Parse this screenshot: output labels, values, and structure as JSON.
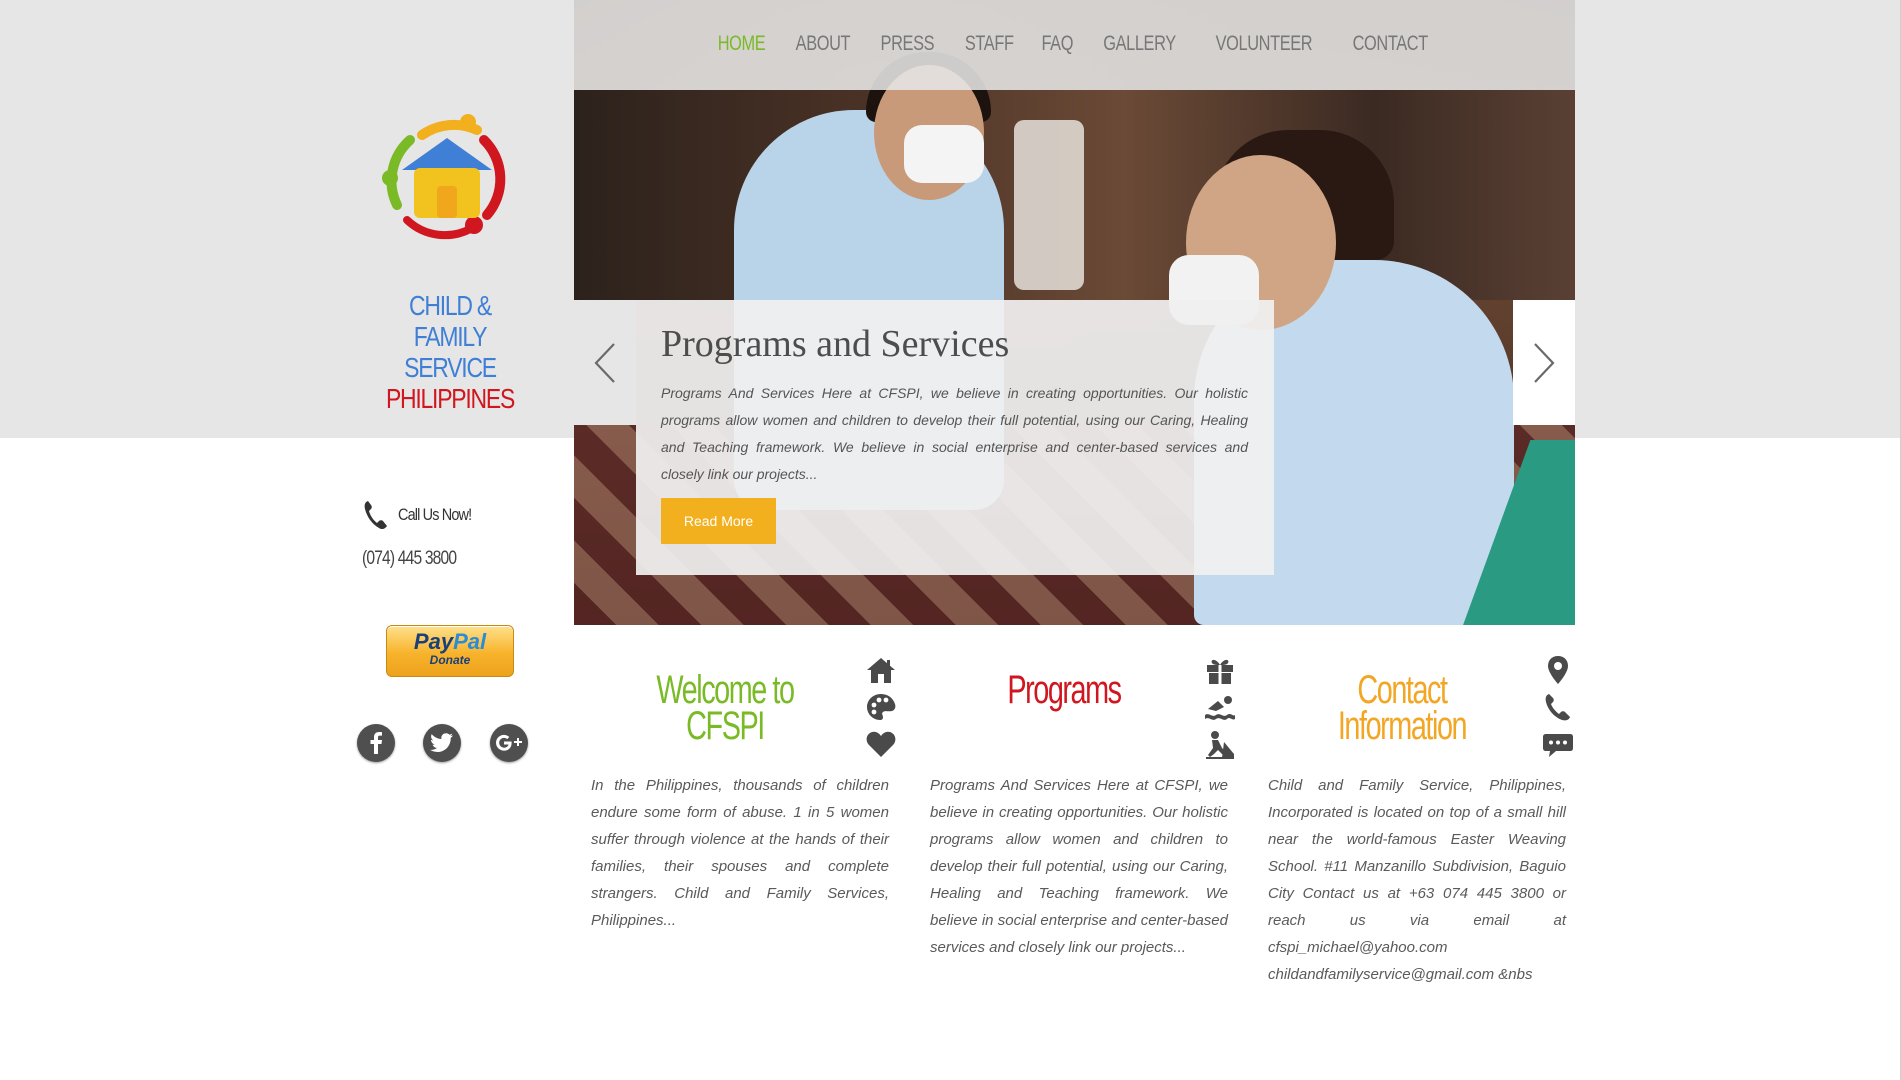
{
  "nav": {
    "items": [
      "HOME",
      "ABOUT",
      "PRESS",
      "STAFF",
      "FAQ",
      "GALLERY",
      "VOLUNTEER",
      "CONTACT"
    ],
    "active": "HOME"
  },
  "logo": {
    "line1": "CHILD & FAMILY",
    "line2": "SERVICE",
    "line3": "PHILIPPINES"
  },
  "sidebar": {
    "call_label": "Call Us Now!",
    "phone": "(074) 445 3800",
    "paypal_logo_part1": "Pay",
    "paypal_logo_part2": "Pal",
    "paypal_sub": "Donate"
  },
  "slider": {
    "title": "Programs and Services",
    "text": "Programs And Services Here at CFSPI, we believe in creating opportunities. Our holistic programs allow women and children to develop  their full potential, using our Caring, Healing and Teaching framework. We believe in social enterprise and center-based services and closely link our projects...",
    "button": "Read More"
  },
  "columns": [
    {
      "title": "Welcome to CFSPI",
      "text": "In the Philippines, thousands of children endure some form of abuse. 1 in 5 women suffer through violence at the hands of their families, their spouses and complete strangers. Child and Family Services, Philippines...",
      "icons": [
        "house-icon",
        "palette-icon",
        "heart-icon"
      ]
    },
    {
      "title": "Programs",
      "text": "Programs And Services Here at CFSPI, we believe in creating opportunities. Our holistic programs allow women and children to develop  their full potential, using our Caring, Healing and Teaching framework. We believe in social enterprise and center-based services and closely link our projects...",
      "icons": [
        "gift-icon",
        "swimmer-icon",
        "construction-worker-icon"
      ]
    },
    {
      "title": "Contact Information",
      "text": "Child and Family Service, Philippines, Incorporated is located on top of a small hill near the world-famous Easter Weaving School. #11 Manzanillo Subdivision, Baguio City Contact us at +63 074 445 3800 or reach us via email at cfspi_michael@yahoo.com childandfamilyservice@gmail.com &nbs",
      "icons": [
        "map-pin-icon",
        "phone-icon",
        "chat-bubble-icon"
      ]
    }
  ],
  "colors": {
    "accent_green": "#7aba26",
    "brand_red": "#d0161e",
    "brand_blue": "#3f7fd6",
    "accent_orange": "#f2b01e",
    "band_gray": "#e6e6e6"
  }
}
